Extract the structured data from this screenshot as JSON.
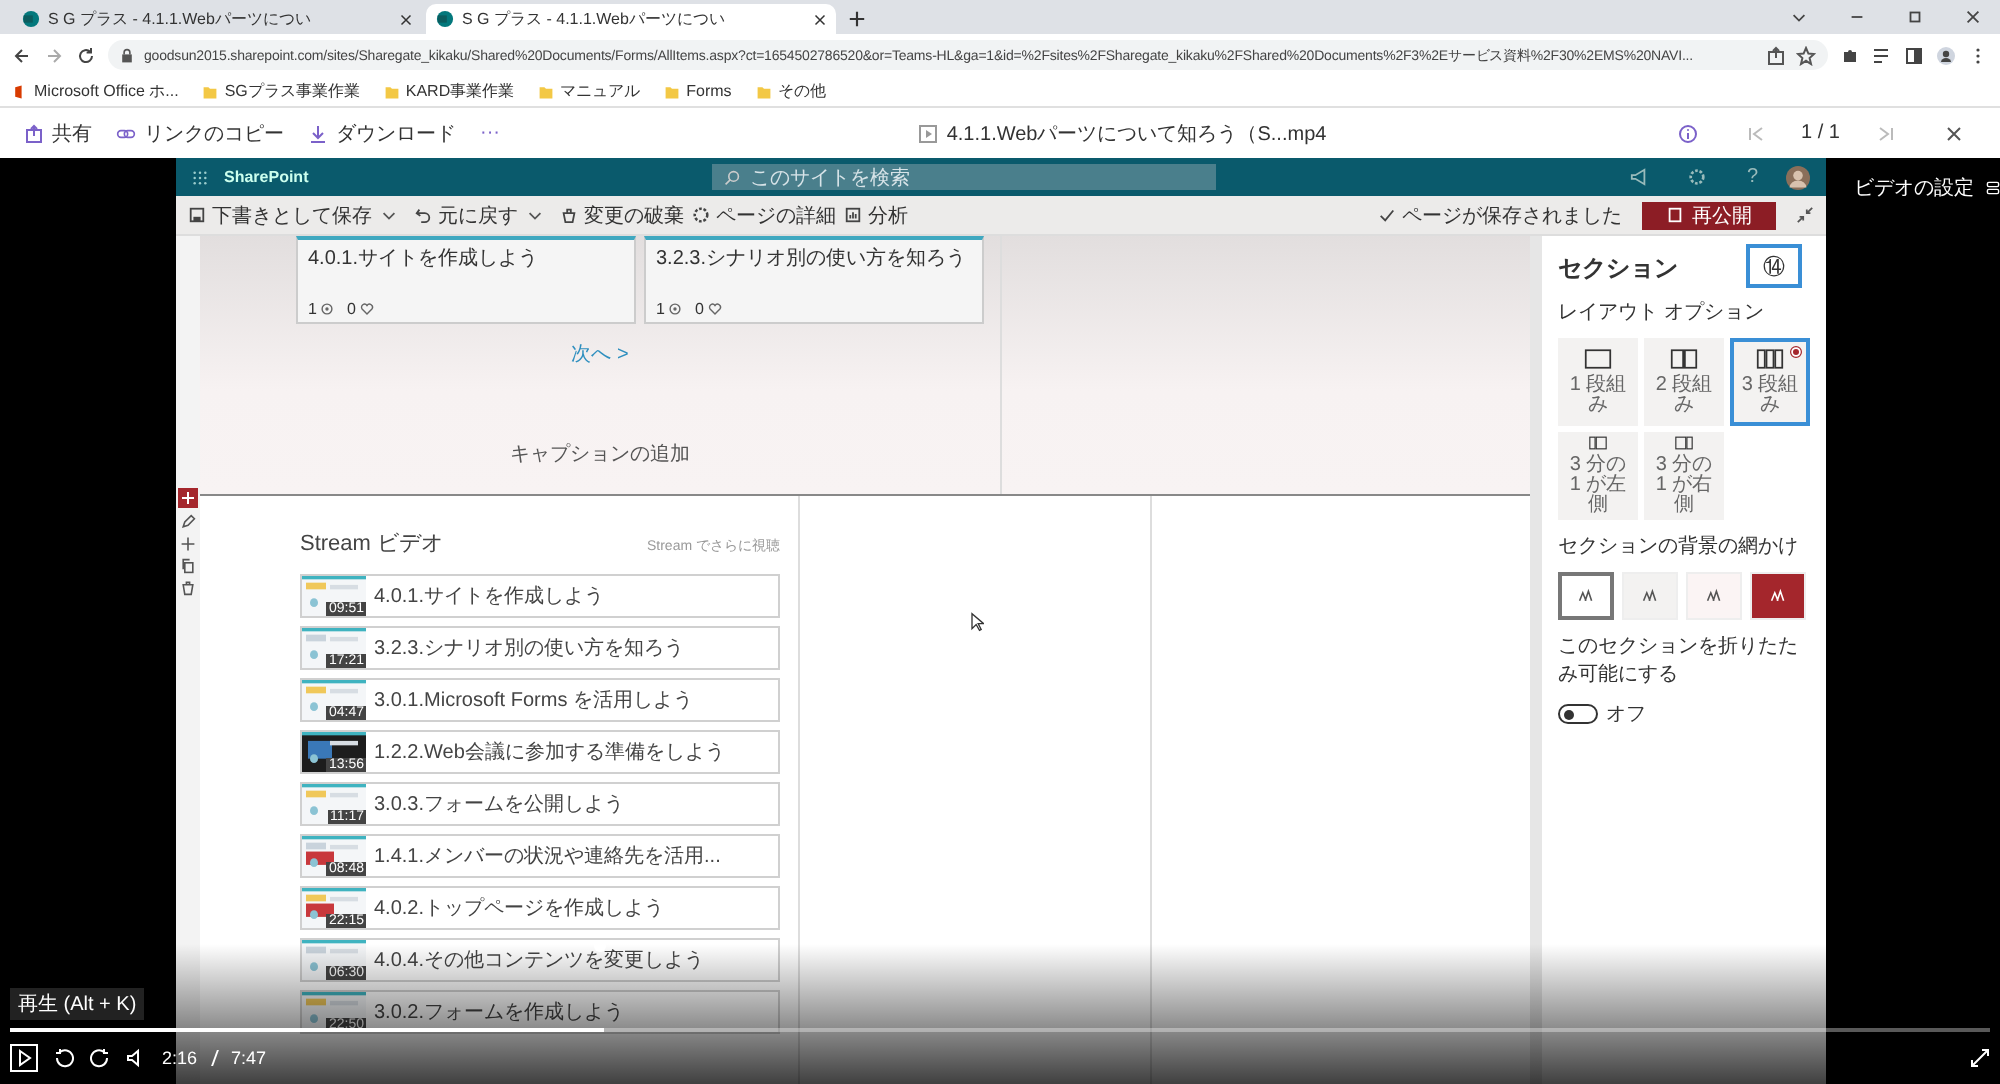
{
  "browser": {
    "tabs": [
      {
        "title": "S G プラス - 4.1.1.Webパーツについ",
        "selected": false
      },
      {
        "title": "S G プラス - 4.1.1.Webパーツについ",
        "selected": true
      }
    ],
    "url": "goodsun2015.sharepoint.com/sites/Sharegate_kikaku/Shared%20Documents/Forms/AllItems.aspx?ct=1654502786520&or=Teams-HL&ga=1&id=%2Fsites%2FSharegate_kikaku%2FShared%20Documents%2F3%2Eサービス資料%2F30%2EMS%20NAVI...",
    "bookmarks": [
      "Microsoft Office ホ...",
      "SGプラス事業作業",
      "KARD事業作業",
      "マニュアル",
      "Forms",
      "その他"
    ]
  },
  "viewer": {
    "actions": [
      "共有",
      "リンクのコピー",
      "ダウンロード"
    ],
    "more": "···",
    "file_name": "4.1.1.Webパーツについて知ろう（S...mp4",
    "page": "1 / 1"
  },
  "sharepoint": {
    "app_name": "SharePoint",
    "search_placeholder": "このサイトを検索",
    "help": "?",
    "commands": [
      "下書きとして保存",
      "元に戻す",
      "変更の破棄",
      "ページの詳細",
      "分析"
    ],
    "save_status": "ページが保存されました",
    "publish": "再公開",
    "cards": [
      {
        "title": "4.0.1.サイトを作成しよう",
        "views": "1",
        "likes": "0"
      },
      {
        "title": "3.2.3.シナリオ別の使い方を知ろう",
        "views": "1",
        "likes": "0"
      }
    ],
    "next": "次へ >",
    "caption": "キャプションの追加",
    "stream": {
      "title": "Stream ビデオ",
      "more": "Stream でさらに視聴",
      "videos": [
        {
          "duration": "09:51",
          "title": "4.0.1.サイトを作成しよう"
        },
        {
          "duration": "17:21",
          "title": "3.2.3.シナリオ別の使い方を知ろう"
        },
        {
          "duration": "04:47",
          "title": "3.0.1.Microsoft Forms を活用しよう"
        },
        {
          "duration": "13:56",
          "title": "1.2.2.Web会議に参加する準備をしよう"
        },
        {
          "duration": "11:17",
          "title": "3.0.3.フォームを公開しよう"
        },
        {
          "duration": "08:48",
          "title": "1.4.1.メンバーの状況や連絡先を活用..."
        },
        {
          "duration": "22:15",
          "title": "4.0.2.トップページを作成しよう"
        },
        {
          "duration": "06:30",
          "title": "4.0.4.その他コンテンツを変更しよう"
        },
        {
          "duration": "22:50",
          "title": "3.0.2.フォームを作成しよう"
        }
      ]
    },
    "panel": {
      "title": "セクション",
      "layout_heading": "レイアウト オプション",
      "layouts": [
        {
          "kind": "one",
          "label": "1 段組み",
          "selected": false
        },
        {
          "kind": "two",
          "label": "2 段組み",
          "selected": false
        },
        {
          "kind": "three",
          "label": "3 段組み",
          "selected": true
        },
        {
          "kind": "left",
          "label": "3 分の 1 が左側",
          "selected": false
        },
        {
          "kind": "right",
          "label": "3 分の 1 が右側",
          "selected": false
        }
      ],
      "callout": "⑭",
      "shading_heading": "セクションの背景の網かけ",
      "shadings": [
        {
          "color": "#ffffff",
          "selected": true
        },
        {
          "color": "#f3f2f1",
          "selected": false
        },
        {
          "color": "#fbf4f4",
          "selected": false
        },
        {
          "color": "#a4262c",
          "selected": false
        }
      ],
      "collapse_label": "このセクションを折りたたみ可能にする",
      "toggle": {
        "on": false,
        "label": "オフ"
      }
    }
  },
  "player": {
    "settings_label": "ビデオの設定",
    "tooltip": "再生 (Alt + K)",
    "level": 0.3,
    "time": "2:16",
    "duration": "7:47"
  }
}
